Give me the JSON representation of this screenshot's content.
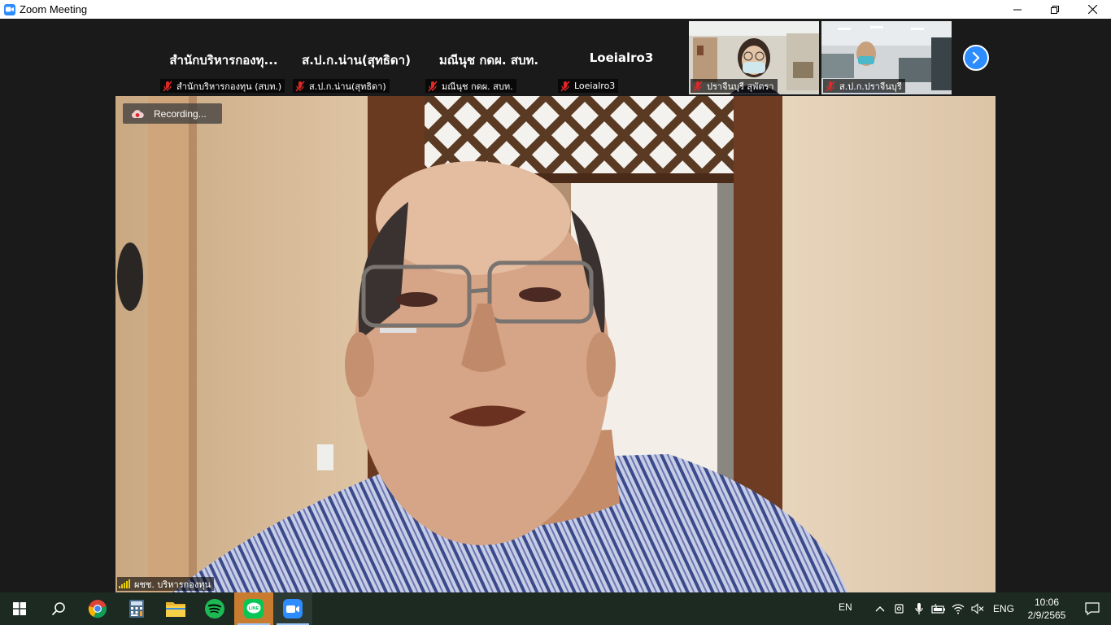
{
  "window": {
    "title": "Zoom Meeting"
  },
  "gallery": {
    "tiles": [
      {
        "display_name": "สำนักบริหารกองทุ...",
        "label": "สำนักบริหารกองทุน (สบท.)",
        "muted": true
      },
      {
        "display_name": "ส.ป.ก.น่าน(สุทธิดา)",
        "label": "ส.ป.ก.น่าน(สุทธิดา)",
        "muted": true
      },
      {
        "display_name": "มณีนุช กดผ. สบท.",
        "label": "มณีนุช กดผ. สบท.",
        "muted": true
      },
      {
        "display_name": "Loeialro3",
        "label": "Loeialro3",
        "muted": true
      },
      {
        "label": "ปราจีนบุรี สุพัตรา",
        "muted": true
      },
      {
        "label": "ส.ป.ก.ปราจีนบุรี",
        "muted": true
      }
    ]
  },
  "main_video": {
    "recording_text": "Recording...",
    "speaker_label": "ผชช. บริหารกองทุน"
  },
  "taskbar": {
    "input_indicator": "EN",
    "language": "ENG",
    "time": "10:06",
    "date": "2/9/2565"
  },
  "colors": {
    "zoom_blue": "#2d8cff",
    "muted_red": "#e02828",
    "taskbar": "#1c2a22"
  }
}
